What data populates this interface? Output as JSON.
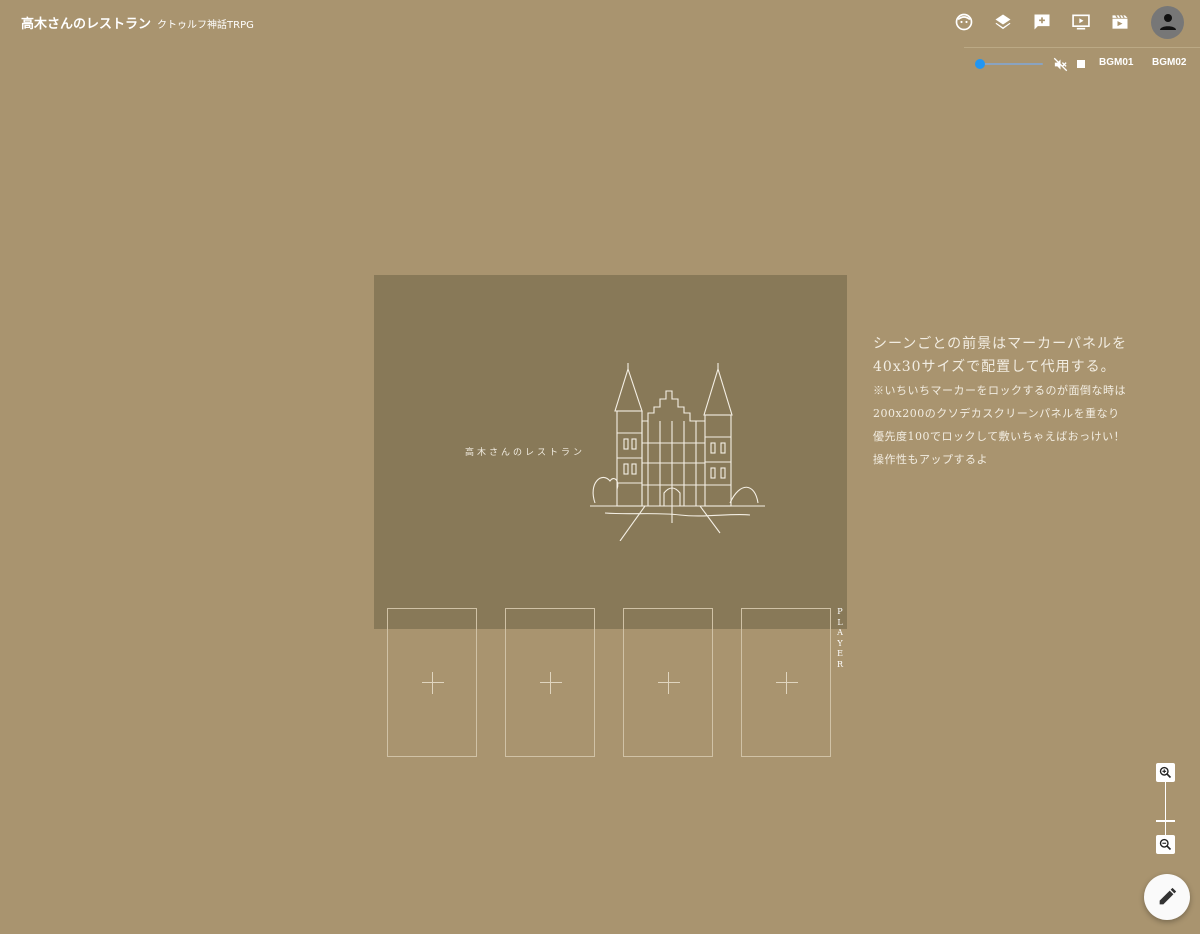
{
  "header": {
    "title": "高木さんのレストラン",
    "subtitle": "クトゥルフ神話TRPG"
  },
  "toolbar": {
    "icons": [
      "face-icon",
      "layers-icon",
      "add-comment-icon",
      "play-video-icon",
      "movie-clapper-icon",
      "account-icon"
    ]
  },
  "bgm": {
    "volume": 0.0,
    "buttons": [
      "BGM01",
      "BGM02"
    ]
  },
  "scene": {
    "caption": "高木さんのレストラン"
  },
  "player_area": {
    "label": "PLAYER",
    "slot_count": 4
  },
  "notes": {
    "line1": "シーンごとの前景はマーカーパネルを",
    "line2": "40x30サイズで配置して代用する。",
    "line3": "※いちいちマーカーをロックするのが面倒な時は",
    "line4": "200x200のクソデカスクリーンパネルを重なり",
    "line5": "優先度100でロックして敷いちゃえばおっけい！",
    "line6": "操作性もアップするよ"
  },
  "colors": {
    "background": "#a9946f",
    "scene_panel": "#887958",
    "accent": "#2196f3"
  }
}
